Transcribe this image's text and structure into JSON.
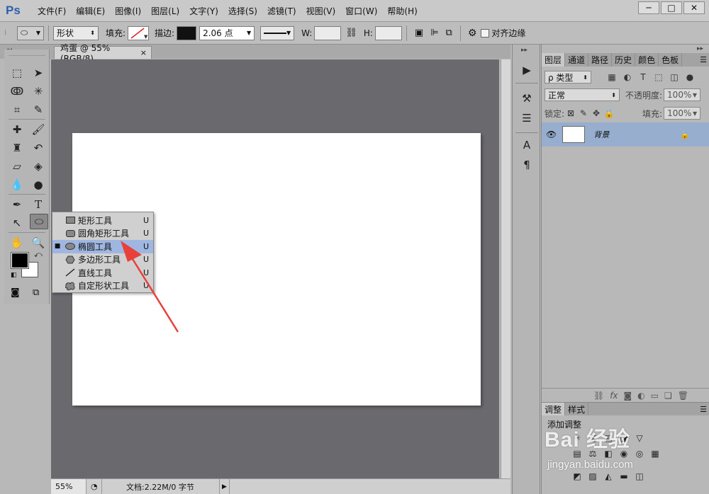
{
  "app": {
    "logo": "Ps"
  },
  "menu": [
    "文件(F)",
    "编辑(E)",
    "图像(I)",
    "图层(L)",
    "文字(Y)",
    "选择(S)",
    "滤镜(T)",
    "视图(V)",
    "窗口(W)",
    "帮助(H)"
  ],
  "window_controls": {
    "minimize": "─",
    "maximize": "□",
    "close": "✕"
  },
  "options": {
    "mode": "形状",
    "fill_label": "填充:",
    "stroke_label": "描边:",
    "stroke_width": "2.06 点",
    "w_label": "W:",
    "h_label": "H:",
    "align_edges_label": "对齐边缘",
    "stroke_color": "#111111"
  },
  "document_tab": {
    "title": "鸡蛋 @ 55%(RGB/8)",
    "close": "×"
  },
  "status": {
    "zoom": "55%",
    "doc_info": "文档:2.22M/0 字节"
  },
  "flyout": {
    "items": [
      {
        "label": "矩形工具",
        "key": "U",
        "icon": "rectangle-icon",
        "selected": false
      },
      {
        "label": "圆角矩形工具",
        "key": "U",
        "icon": "rounded-rectangle-icon",
        "selected": false
      },
      {
        "label": "椭圆工具",
        "key": "U",
        "icon": "ellipse-icon",
        "selected": true
      },
      {
        "label": "多边形工具",
        "key": "U",
        "icon": "polygon-icon",
        "selected": false
      },
      {
        "label": "直线工具",
        "key": "U",
        "icon": "line-icon",
        "selected": false
      },
      {
        "label": "自定形状工具",
        "key": "U",
        "icon": "custom-shape-icon",
        "selected": false
      }
    ]
  },
  "layers_panel": {
    "tabs": [
      "图层",
      "通道",
      "路径",
      "历史",
      "颜色",
      "色板"
    ],
    "filter": "ρ 类型",
    "blend_mode": "正常",
    "opacity_label": "不透明度:",
    "opacity": "100%",
    "lock_label": "锁定:",
    "fill_label": "填充:",
    "fill": "100%",
    "layer_name": "背景",
    "footer_icons": [
      "link-icon",
      "fx-icon",
      "mask-icon",
      "adjustment-icon",
      "folder-icon",
      "new-layer-icon",
      "trash-icon"
    ]
  },
  "adjustments_panel": {
    "tabs": [
      "调整",
      "样式"
    ],
    "title": "添加调整"
  },
  "watermark": {
    "brand": "Bai 经验",
    "url": "jingyan.baidu.com"
  },
  "colors": {
    "accent": "#2b5fb0",
    "canvas_bg": "#6a696e",
    "selection": "#9fb6e0",
    "layer_selected": "#97aecf",
    "arrow": "#e8403a"
  }
}
